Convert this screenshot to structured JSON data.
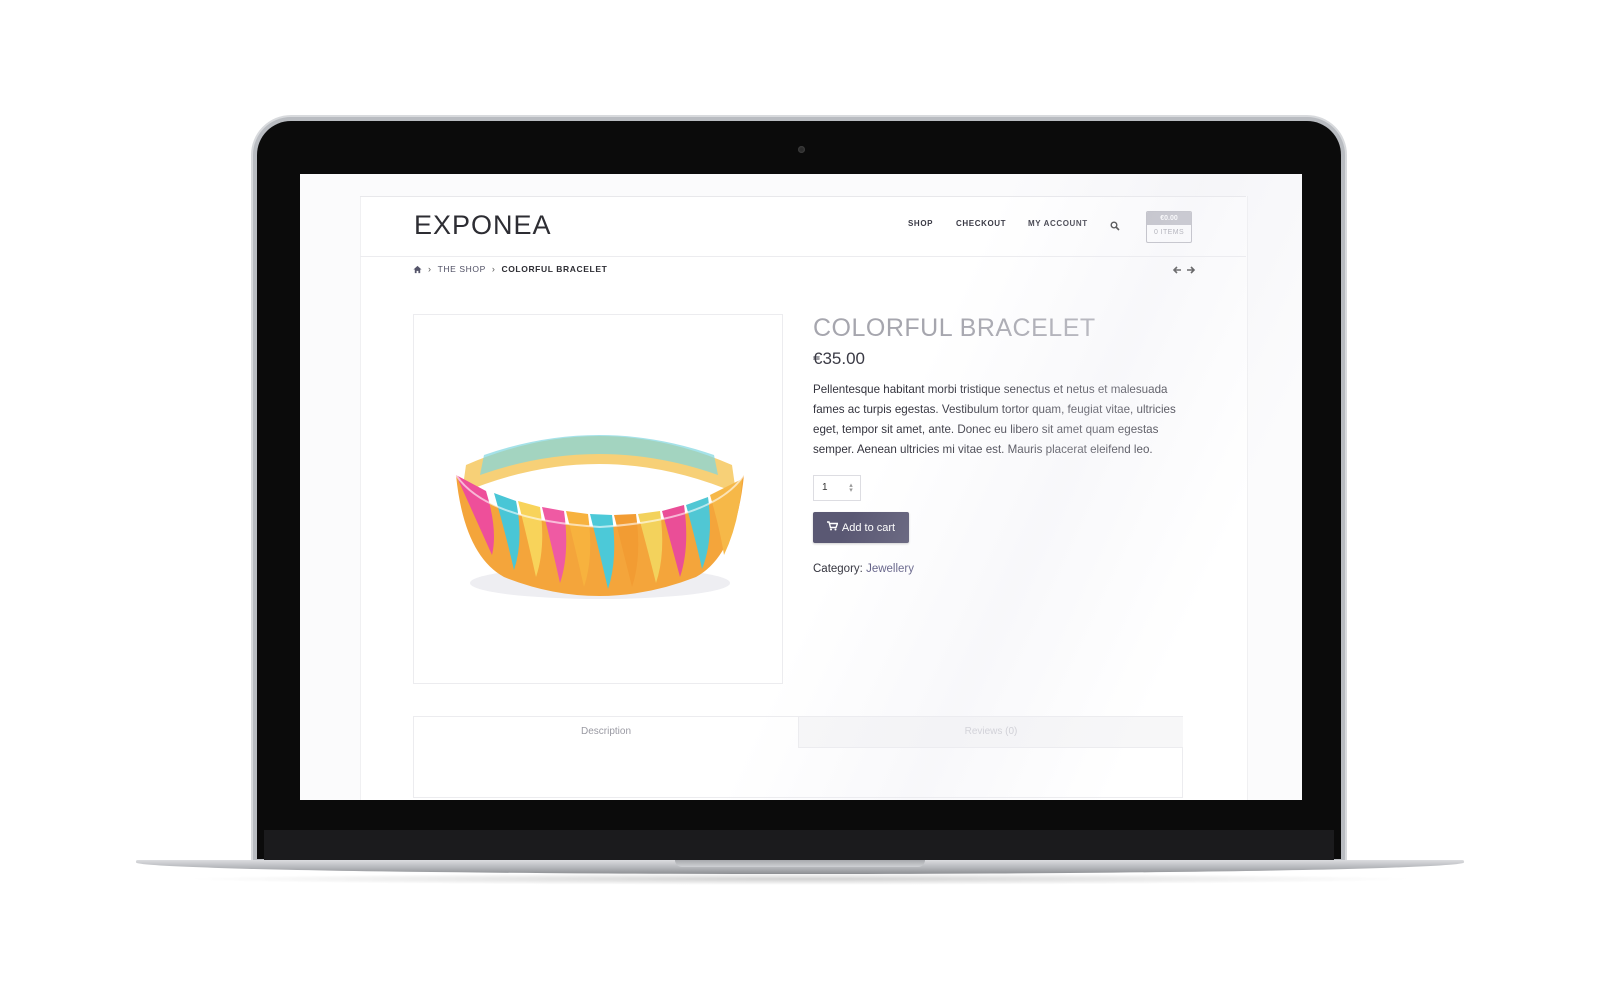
{
  "site": {
    "logo": "EXPONEA",
    "nav": {
      "shop": "SHOP",
      "checkout": "CHECKOUT",
      "account": "MY ACCOUNT"
    },
    "cart": {
      "total": "€0.00",
      "items": "0 ITEMS"
    }
  },
  "breadcrumb": {
    "shop": "THE SHOP",
    "current": "COLORFUL BRACELET"
  },
  "product": {
    "title": "COLORFUL BRACELET",
    "price": "€35.00",
    "description": "Pellentesque habitant morbi tristique senectus et netus et malesuada fames ac turpis egestas. Vestibulum tortor quam, feugiat vitae, ultricies eget, tempor sit amet, ante. Donec eu libero sit amet quam egestas semper. Aenean ultricies mi vitae est. Mauris placerat eleifend leo.",
    "quantity": "1",
    "add_to_cart": "Add to cart",
    "category_label": "Category:",
    "category": "Jewellery"
  },
  "tabs": {
    "description": "Description",
    "reviews": "Reviews (0)"
  },
  "colors": {
    "button": "#5a5873",
    "title": "#a6a6ae",
    "laptop_bezel": "#0b0b0b"
  },
  "icons": [
    "home-icon",
    "search-icon",
    "cart-icon",
    "arrow-left-icon",
    "arrow-right-icon"
  ]
}
